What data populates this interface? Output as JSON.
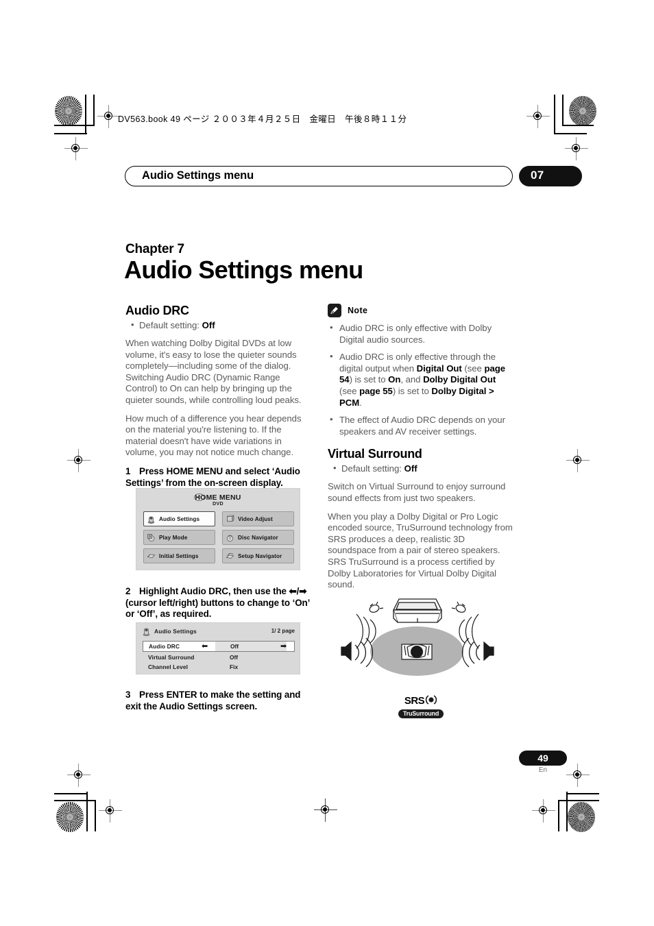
{
  "slug": {
    "text": "DV563.book  49 ページ  ２００３年４月２５日　金曜日　午後８時１１分"
  },
  "running_head": {
    "title": "Audio Settings menu",
    "chapter_tab": "07"
  },
  "chapter": {
    "label": "Chapter 7",
    "title": "Audio Settings menu"
  },
  "left_column": {
    "section_title": "Audio DRC",
    "default_prefix": "Default setting: ",
    "default_value": "Off",
    "paragraph_1": "When watching Dolby Digital DVDs at low volume, it's easy to lose the quieter sounds completely—including some of the dialog. Switching Audio DRC (Dynamic Range Control) to On can help by bringing up the quieter sounds, while controlling loud peaks.",
    "paragraph_2": "How much of a difference you hear depends on the material you're listening to. If the material doesn't have wide variations in volume, you may not notice much change.",
    "step_1_num": "1",
    "step_1_text": "Press HOME MENU and select ‘Audio Settings’ from the on-screen display.",
    "step_2_num": "2",
    "step_2_text_a": "Highlight Audio DRC, then use the ",
    "step_2_text_b": " (cursor left/right) buttons to change to ‘On’ or ‘Off’, as required.",
    "step_3_num": "3",
    "step_3_text": "Press ENTER to make the setting and exit the Audio Settings screen."
  },
  "home_menu_osd": {
    "title": "HOME MENU",
    "subtitle": "DVD",
    "buttons": [
      {
        "label": "Audio Settings",
        "selected": true
      },
      {
        "label": "Video Adjust",
        "selected": false
      },
      {
        "label": "Play Mode",
        "selected": false
      },
      {
        "label": "Disc Navigator",
        "selected": false
      },
      {
        "label": "Initial Settings",
        "selected": false
      },
      {
        "label": "Setup Navigator",
        "selected": false
      }
    ]
  },
  "audio_settings_osd": {
    "title": "Audio Settings",
    "page_indicator": "1/ 2 page",
    "rows": [
      {
        "name": "Audio DRC",
        "value": "Off",
        "highlighted": true
      },
      {
        "name": "Virtual Surround",
        "value": "Off",
        "highlighted": false
      },
      {
        "name": "Channel Level",
        "value": "Fix",
        "highlighted": false
      }
    ],
    "arrow_left": "←",
    "arrow_right": "→"
  },
  "note_block": {
    "title": "Note",
    "items": [
      [
        {
          "t": "Audio DRC is only effective with Dolby Digital audio sources.",
          "b": false
        }
      ],
      [
        {
          "t": "Audio DRC is only effective through the digital output when ",
          "b": false
        },
        {
          "t": "Digital Out",
          "b": true
        },
        {
          "t": " (see ",
          "b": false
        },
        {
          "t": "page 54",
          "b": true
        },
        {
          "t": ") is set to ",
          "b": false
        },
        {
          "t": "On",
          "b": true
        },
        {
          "t": ", and ",
          "b": false
        },
        {
          "t": "Dolby Digital Out",
          "b": true
        },
        {
          "t": " (see ",
          "b": false
        },
        {
          "t": "page 55",
          "b": true
        },
        {
          "t": ") is set to ",
          "b": false
        },
        {
          "t": "Dolby Digital > PCM",
          "b": true
        },
        {
          "t": ".",
          "b": false
        }
      ],
      [
        {
          "t": "The effect of Audio DRC depends on your speakers and AV receiver settings.",
          "b": false
        }
      ]
    ]
  },
  "right_column": {
    "section_title": "Virtual Surround",
    "default_prefix": "Default setting: ",
    "default_value": "Off",
    "paragraph_1": "Switch on Virtual Surround to enjoy surround sound effects from just two speakers.",
    "paragraph_2": "When you play a Dolby Digital or Pro Logic encoded source, TruSurround technology from SRS produces a deep, realistic 3D soundspace from a pair of stereo speakers. SRS TruSurround is a process certified by Dolby Laboratories for Virtual Dolby Digital sound."
  },
  "srs_logo": {
    "line1": "SRS",
    "line2": "TruSurround"
  },
  "footer": {
    "page_number": "49",
    "language": "En"
  },
  "colors": {
    "ink": "#000000",
    "body_text": "#5b5b5d",
    "osd_bg": "#d9d9d9",
    "osd_button": "#c2c2c2",
    "tab_bg": "#111111"
  }
}
